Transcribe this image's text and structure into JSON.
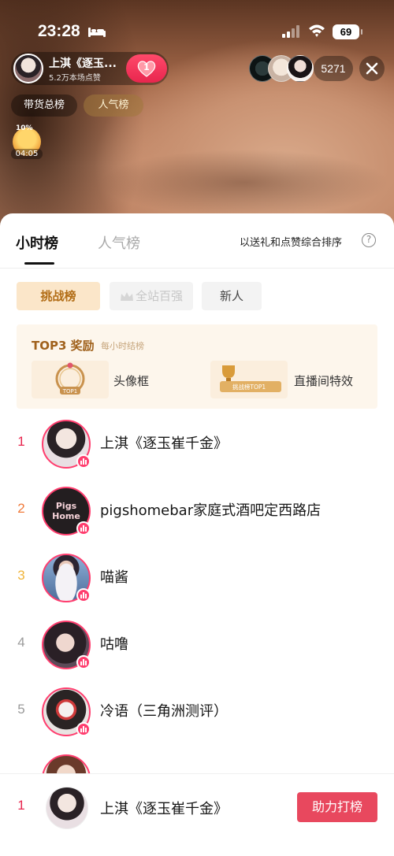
{
  "status_bar": {
    "time": "23:28",
    "battery": "69"
  },
  "host": {
    "name": "上淇《逐玉...",
    "likes": "5.2万本场点赞",
    "heart_count": "1"
  },
  "viewers": {
    "count": "5271"
  },
  "top_pills": {
    "sales": "带货总榜",
    "popularity": "人气榜"
  },
  "gift_badge": {
    "percent": "10%",
    "timer": "04:05"
  },
  "sheet": {
    "tabs": [
      "小时榜",
      "人气榜"
    ],
    "sort_note": "以送礼和点赞综合排序",
    "help": "?",
    "chips": {
      "challenge": "挑战榜",
      "top100": "全站百强",
      "new": "新人"
    },
    "reward": {
      "title": "TOP3 奖励",
      "subtitle": "每小时结榜",
      "frame_badge": "TOP1",
      "frame_label": "头像框",
      "effect_badge": "挑战榜TOP1",
      "effect_label": "直播间特效"
    }
  },
  "ranking": [
    {
      "rank": "1",
      "name": "上淇《逐玉崔千金》",
      "color": "#e8264e"
    },
    {
      "rank": "2",
      "name": "pigshomebar家庭式酒吧定西路店",
      "color": "#f07a3a",
      "avatar_text": "Pigs Home"
    },
    {
      "rank": "3",
      "name": "喵酱",
      "color": "#f0b43a"
    },
    {
      "rank": "4",
      "name": "咕噜",
      "color": "#9a9a9a"
    },
    {
      "rank": "5",
      "name": "冷语（三角洲测评）",
      "color": "#9a9a9a"
    }
  ],
  "bottom": {
    "rank": "1",
    "name": "上淇《逐玉崔千金》",
    "button": "助力打榜"
  },
  "colors": {
    "accent": "#e8264e",
    "gold": "#b26d16",
    "live_ring": "#ff3d6e"
  }
}
